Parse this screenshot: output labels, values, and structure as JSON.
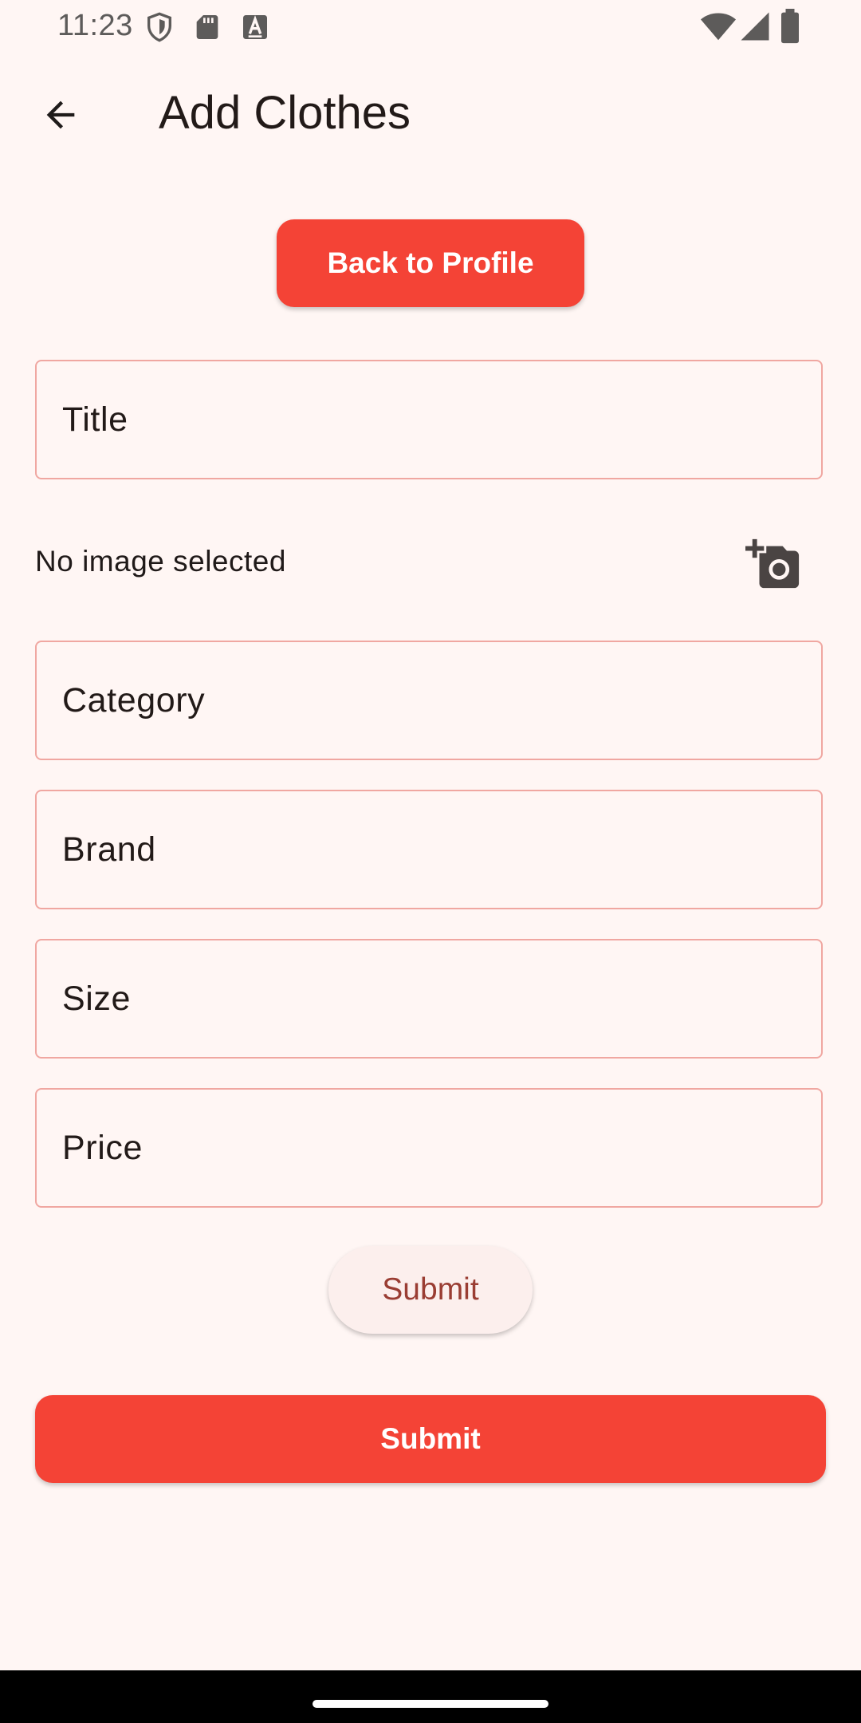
{
  "status_bar": {
    "time": "11:23",
    "icons_left": [
      "shield-icon",
      "sd-card-icon",
      "text-a-icon"
    ],
    "icons_right": [
      "wifi-icon",
      "cell-signal-icon",
      "battery-icon"
    ]
  },
  "app_bar": {
    "back_icon": "arrow-back-icon",
    "title": "Add Clothes"
  },
  "actions": {
    "back_to_profile_label": "Back to Profile"
  },
  "form": {
    "title_placeholder": "Title",
    "image_status": "No image selected",
    "image_picker_icon": "add-a-photo-icon",
    "category_placeholder": "Category",
    "brand_placeholder": "Brand",
    "size_placeholder": "Size",
    "price_placeholder": "Price"
  },
  "submit": {
    "secondary_label": "Submit",
    "primary_label": "Submit"
  },
  "colors": {
    "background": "#fff6f4",
    "accent": "#f44336",
    "field_border": "#f0a7a1",
    "tonal_button_bg": "#fcefed",
    "tonal_button_text": "#9a3d33"
  }
}
